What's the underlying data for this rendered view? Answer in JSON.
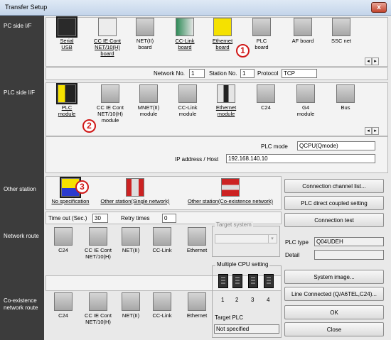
{
  "window": {
    "title": "Transfer Setup",
    "close_glyph": "x"
  },
  "sidebar": {
    "pc_side": "PC side I/F",
    "plc_side": "PLC side I/F",
    "other_station": "Other station",
    "network_route": "Network route",
    "coexistence_route": "Co-existence network route"
  },
  "pc_side": {
    "items": [
      {
        "label": "Serial USB",
        "icon": "usb-icon"
      },
      {
        "label": "CC IE Cont NET/10(H) board",
        "icon": "cc-ie-board-icon"
      },
      {
        "label": "NET(II) board",
        "icon": "net-board-icon"
      },
      {
        "label": "CC-Link board",
        "icon": "cc-link-board-icon"
      },
      {
        "label": "Ethernet board",
        "icon": "ethernet-board-icon"
      },
      {
        "label": "PLC board",
        "icon": "plc-board-icon"
      },
      {
        "label": "AF board",
        "icon": "af-board-icon"
      },
      {
        "label": "SSC net",
        "icon": "ssc-net-icon"
      }
    ],
    "network_no_label": "Network No.",
    "network_no": "1",
    "station_no_label": "Station No.",
    "station_no": "1",
    "protocol_label": "Protocol",
    "protocol": "TCP"
  },
  "plc_side": {
    "items": [
      {
        "label": "PLC module",
        "icon": "plc-module-icon"
      },
      {
        "label": "CC IE Cont NET/10(H) module",
        "icon": "cc-ie-module-icon"
      },
      {
        "label": "MNET(II) module",
        "icon": "mnet-module-icon"
      },
      {
        "label": "CC-Link module",
        "icon": "cc-link-module-icon"
      },
      {
        "label": "Ethernet module",
        "icon": "ethernet-module-icon"
      },
      {
        "label": "C24",
        "icon": "c24-icon"
      },
      {
        "label": "G4 module",
        "icon": "g4-module-icon"
      },
      {
        "label": "Bus",
        "icon": "bus-icon"
      }
    ],
    "plc_mode_label": "PLC mode",
    "plc_mode": "QCPU(Qmode)",
    "ip_label": "IP address / Host",
    "ip": "192.168.140.10"
  },
  "other_station": {
    "items": [
      {
        "label": "No specification"
      },
      {
        "label": "Other station(Single network)"
      },
      {
        "label": "Other station(Co-existence network)"
      }
    ],
    "timeout_label": "Time out (Sec.)",
    "timeout": "30",
    "retry_label": "Retry times",
    "retry": "0"
  },
  "network_route": {
    "items": [
      "C24",
      "CC IE Cont NET/10(H)",
      "NET(II)",
      "CC-Link",
      "Ethernet"
    ]
  },
  "coexistence_route": {
    "items": [
      "C24",
      "CC IE Cont NET/10(H)",
      "NET(II)",
      "CC-Link",
      "Ethernet"
    ]
  },
  "target_system": {
    "label": "Target system"
  },
  "multi_cpu": {
    "label": "Multiple CPU setting",
    "cpus": [
      "1",
      "2",
      "3",
      "4"
    ],
    "target_plc_label": "Target PLC",
    "target_plc": "Not specified"
  },
  "buttons": {
    "connection_channel_list": "Connection channel list...",
    "plc_direct": "PLC direct coupled setting",
    "connection_test": "Connection test",
    "system_image": "System image...",
    "line_connected": "Line Connected (Q/A6TEL,C24)...",
    "ok": "OK",
    "close": "Close"
  },
  "plc_type_label": "PLC type",
  "plc_type": "Q04UDEH",
  "detail_label": "Detail",
  "scroll": {
    "left": "◂",
    "right": "▸"
  },
  "markers": [
    "1",
    "2",
    "3"
  ]
}
